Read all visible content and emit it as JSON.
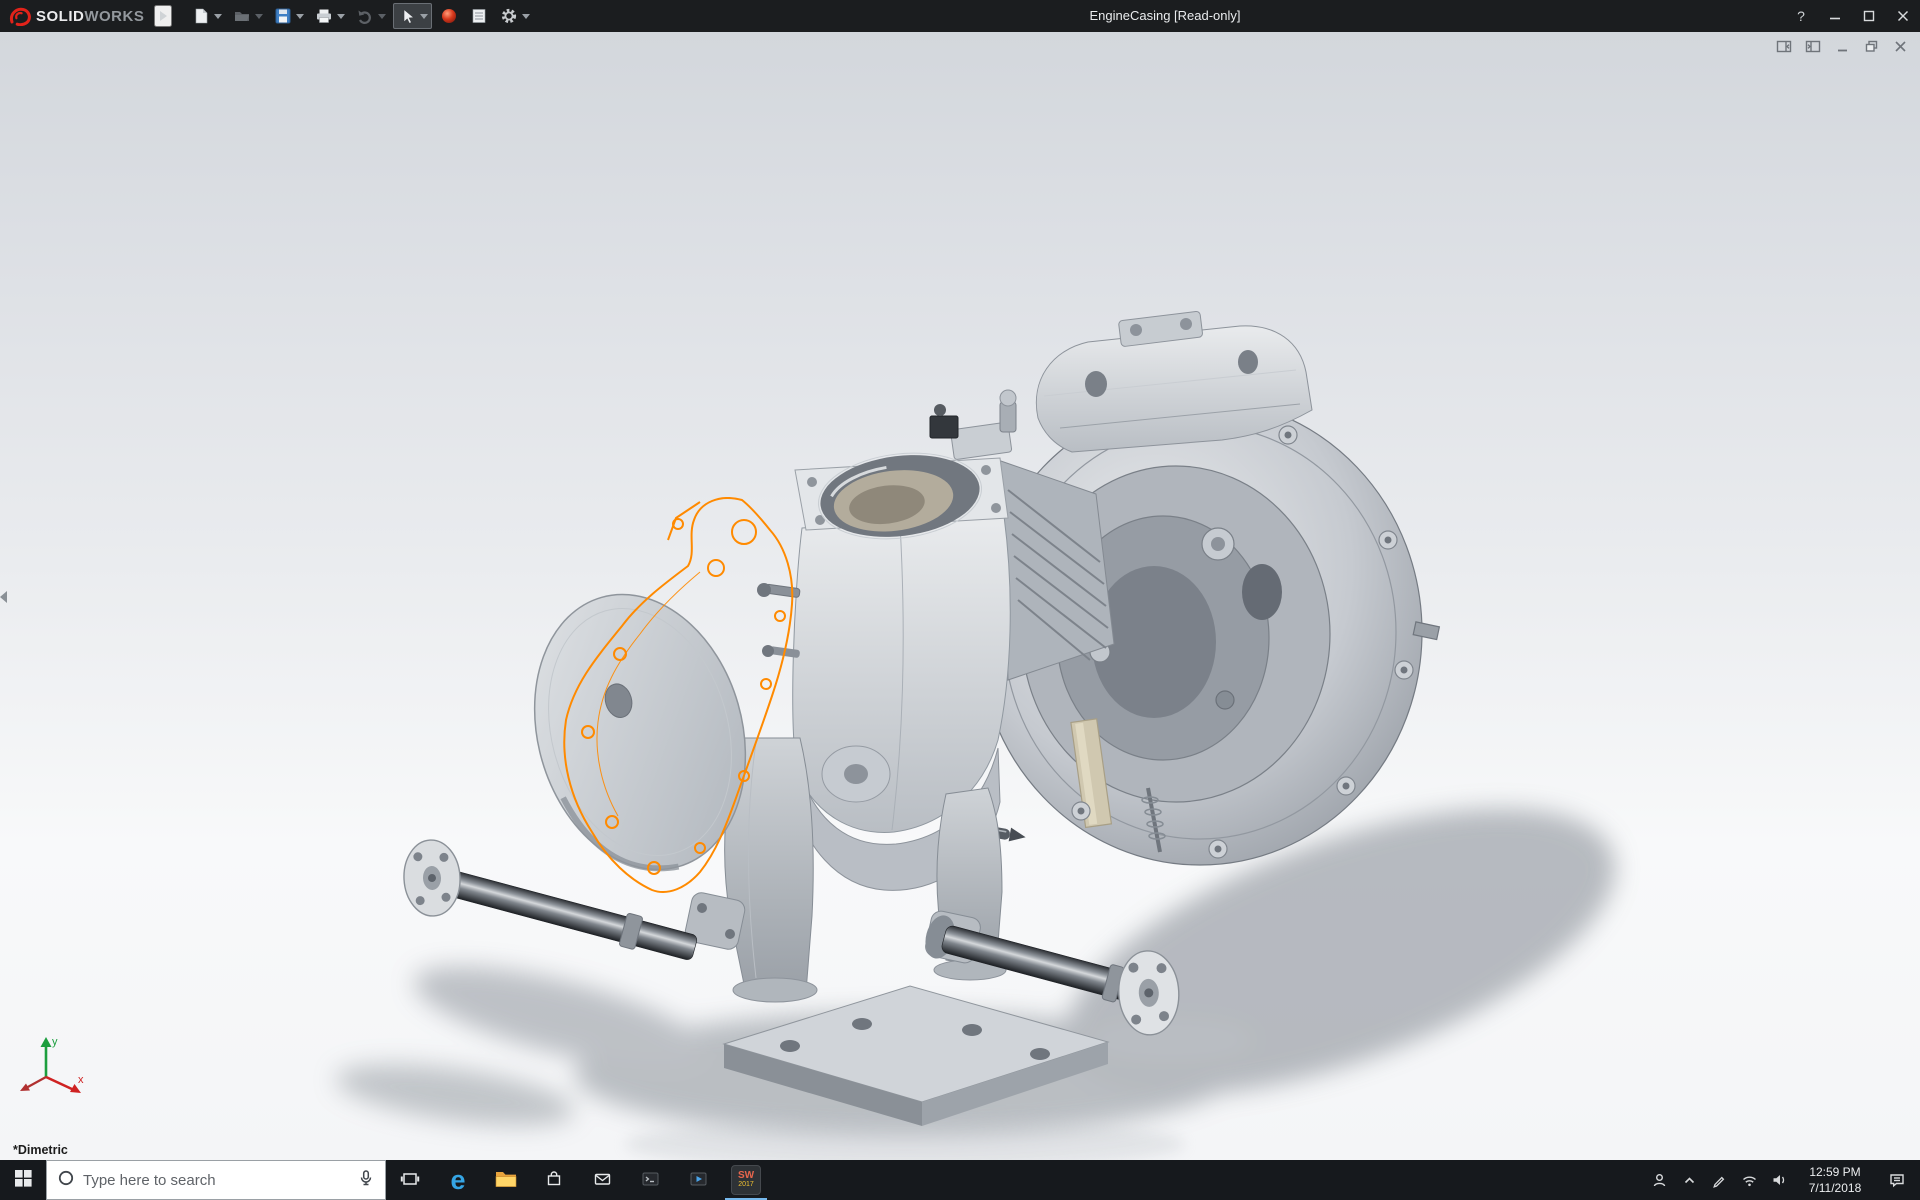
{
  "window": {
    "title": "EngineCasing [Read-only]"
  },
  "brand": {
    "solid": "SOLID",
    "works": "WORKS"
  },
  "titlebar": {
    "help": "?"
  },
  "viewport": {
    "orientation": "*Dimetric",
    "triad": {
      "x": "x",
      "y": "y"
    }
  },
  "taskbar": {
    "search_placeholder": "Type here to search",
    "edge_glyph": "e",
    "solidworks_mark": "SW",
    "solidworks_year": "2017",
    "time": "12:59 PM",
    "date": "7/11/2018"
  },
  "colors": {
    "titlebar_bg": "#1b1d1f",
    "taskbar_bg": "#16191d",
    "logo_red": "#e2231a",
    "sketch_orange": "#ff8a00",
    "viewport_top": "#d3d7dc",
    "viewport_bottom": "#f4f5f7",
    "save_blue": "#3f7fc4"
  }
}
